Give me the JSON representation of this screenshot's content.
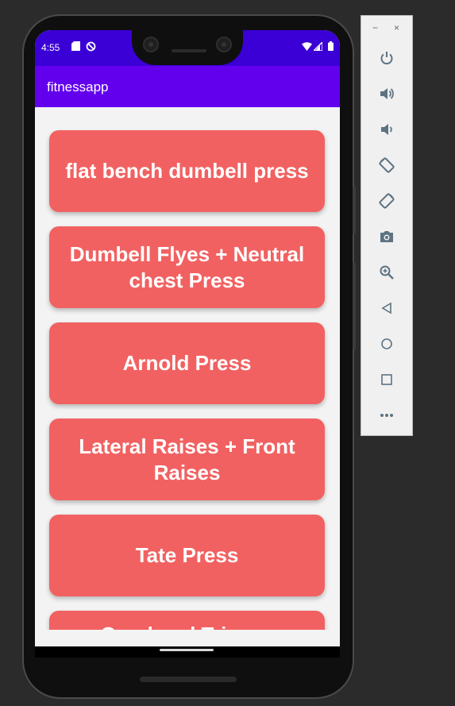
{
  "status_bar": {
    "time": "4:55"
  },
  "app_bar": {
    "title": "fitnessapp"
  },
  "exercises": [
    "flat bench dumbell press",
    "Dumbell Flyes + Neutral chest Press",
    "Arnold Press",
    "Lateral Raises + Front Raises",
    "Tate Press",
    "Overhead Triceps Extension"
  ],
  "colors": {
    "status_bar": "#3a00d6",
    "app_bar": "#6200ee",
    "card": "#f26161",
    "screen_bg": "#f3f3f3"
  },
  "emulator_toolbar": {
    "window_controls": [
      "−",
      "×"
    ],
    "buttons": [
      "power-icon",
      "volume-up-icon",
      "volume-down-icon",
      "rotate-left-icon",
      "rotate-right-icon",
      "camera-icon",
      "zoom-icon",
      "back-icon",
      "home-icon",
      "overview-icon",
      "more-icon"
    ]
  }
}
